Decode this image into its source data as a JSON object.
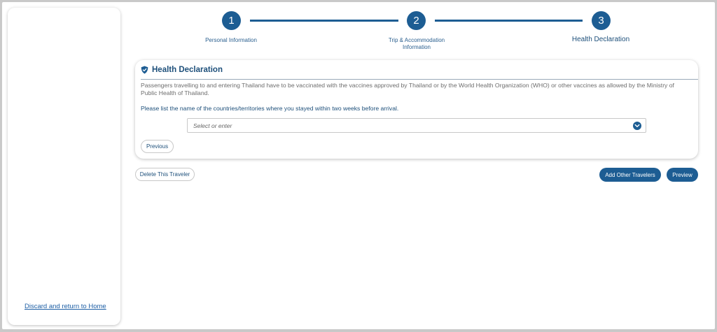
{
  "sidebar": {
    "discard_link": "Discard and return to Home"
  },
  "stepper": {
    "steps": [
      {
        "number": "1",
        "label": "Personal Information"
      },
      {
        "number": "2",
        "label_line1": "Trip & Accommodation",
        "label_line2": "Information"
      },
      {
        "number": "3",
        "label": "Health Declaration"
      }
    ],
    "active_step": 3
  },
  "card": {
    "title": "Health Declaration",
    "title_icon": "shield-icon",
    "description": "Passengers travelling to and entering Thailand have to be vaccinated with the vaccines approved by Thailand or by the World Health Organization (WHO) or other vaccines as allowed by the Ministry of Public Health of Thailand.",
    "instruction": "Please list the name of the countries/territories where you stayed within two weeks before arrival.",
    "countries_select": {
      "placeholder": "Select or enter",
      "value": ""
    },
    "previous_button": "Previous"
  },
  "actions": {
    "delete_traveler": "Delete This Traveler",
    "add_other_travelers": "Add Other Travelers",
    "preview": "Preview"
  },
  "colors": {
    "primary": "#1d5d93",
    "heading": "#1d4f7a",
    "link": "#1e5fa5",
    "body_text": "#6d6d6d"
  }
}
